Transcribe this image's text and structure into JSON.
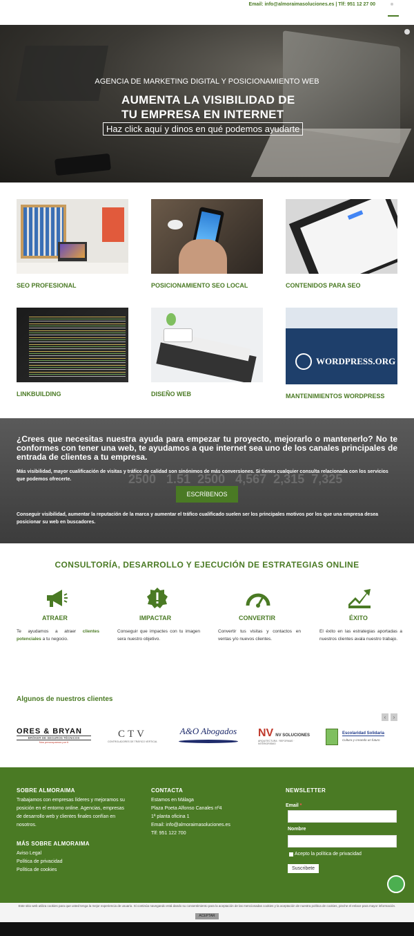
{
  "topbar": {
    "contact": "Email: info@almoraimasoluciones.es | Tlf: 951 12 27 00"
  },
  "hero": {
    "kicker": "AGENCIA DE MARKETING DIGITAL Y POSICIONAMIENTO WEB",
    "title_line1": "AUMENTA LA VISIBILIDAD DE",
    "title_line2": "TU EMPRESA EN INTERNET",
    "cta": "Haz click aquí y dinos en qué podemos ayudarte"
  },
  "services": [
    {
      "title": "SEO PROFESIONAL"
    },
    {
      "title": "POSICIONAMIENTO SEO LOCAL"
    },
    {
      "title": "CONTENIDOS PARA SEO"
    },
    {
      "title": "LINKBUILDING"
    },
    {
      "title": "DISEÑO WEB"
    },
    {
      "title": "MANTENIMIENTOS WORDPRESS"
    }
  ],
  "band": {
    "question": "¿Crees que necesitas nuestra ayuda para empezar tu proyecto, mejorarlo o mantenerlo? No te conformes con tener una web, te ayudamos a que internet sea uno de los canales principales de entrada de clientes a tu empresa.",
    "text1": "Más visibilidad, mayor cualificación de visitas y tráfico de calidad son sinónimos de más conversiones. Si tienes cualquier consulta relacionada con los servicios que podemos ofrecerte.",
    "button": "ESCRÍBENOS",
    "text2": "Conseguir visibilidad, aumentar la reputación de la marca y aumentar el tráfico cualificado suelen ser los principales motivos por los que una empresa desea posicionar su web en buscadores."
  },
  "consult": {
    "title": "CONSULTORÍA, DESARROLLO Y EJECUCIÓN DE ESTRATEGIAS ONLINE",
    "pillars": [
      {
        "title": "ATRAER",
        "pre": "Te ayudamos a atraer ",
        "highlight": "clientes potenciales",
        "post": " a tu negocio.",
        "icon": "megaphone-icon"
      },
      {
        "title": "IMPACTAR",
        "desc": "Conseguir que impactes con tu imagen sera nuestro objetivo.",
        "icon": "alert-badge-icon"
      },
      {
        "title": "CONVERTIR",
        "desc": "Convertir tus visitas y contactos en ventas y/o nuevos clientes.",
        "icon": "gauge-icon"
      },
      {
        "title": "ÉXITO",
        "desc": "El éxito en las estrategias aportadas a nuestros clientes avala nuestro trabajo.",
        "icon": "growth-chart-icon"
      }
    ]
  },
  "clients": {
    "title": "Algunos de nuestros clientes",
    "prev": "‹",
    "next": "›",
    "logos": [
      {
        "name": "ORES & BRYAN",
        "sub": "BRÓKER DE SEGUROS TÉCNICOS",
        "tag": "Nos preocupamos por ti"
      },
      {
        "name": "CTV",
        "sub": "CONTROLADORES DE TRÁFICO VERTICAL"
      },
      {
        "name": "A&O Abogados"
      },
      {
        "name": "NV SOLUCIONES",
        "sub": "ARQUITECTURA · REFORMAS · INTERIORISMO"
      },
      {
        "name": "Escolaridad Solidaria",
        "sub": "Cultura y creando un futuro"
      }
    ]
  },
  "footer": {
    "about_title": "SOBRE ALMORAIMA",
    "about_text": "Trabajamos con empresas líderes y mejoramos su posición en el entorno online. Agencias, empresas de desarrollo web y clientes finales confían en nosotros.",
    "more_title": "MÁS SOBRE ALMORAIMA",
    "more_links": [
      "Aviso Legal",
      "Política de privacidad",
      "Política de cookies"
    ],
    "contact_title": "CONTACTA",
    "contact_lines": [
      "Estamos en Málaga",
      "Plaza Poeta Alfonso Canales nº4",
      "1ª planta oficina 1",
      "Email: info@almoraimasoluciones.es",
      "Tlf: 951 122 700"
    ],
    "newsletter_title": "NEWSLETTER",
    "email_label": "Email",
    "email_required": "*",
    "name_label": "Nombre",
    "privacy_label": "Acepto la política de privacidad",
    "subscribe": "Suscribete"
  },
  "cookie": {
    "text": "Este sitio web utiliza cookies para que usted tenga la mejor experiencia de usuario. Si continúa navegando está dando su consentimiento para la aceptación de las mencionadas cookies y la aceptación de nuestra política de cookies, pinche el enlace para mayor información.",
    "accept": "ACEPTAR"
  }
}
